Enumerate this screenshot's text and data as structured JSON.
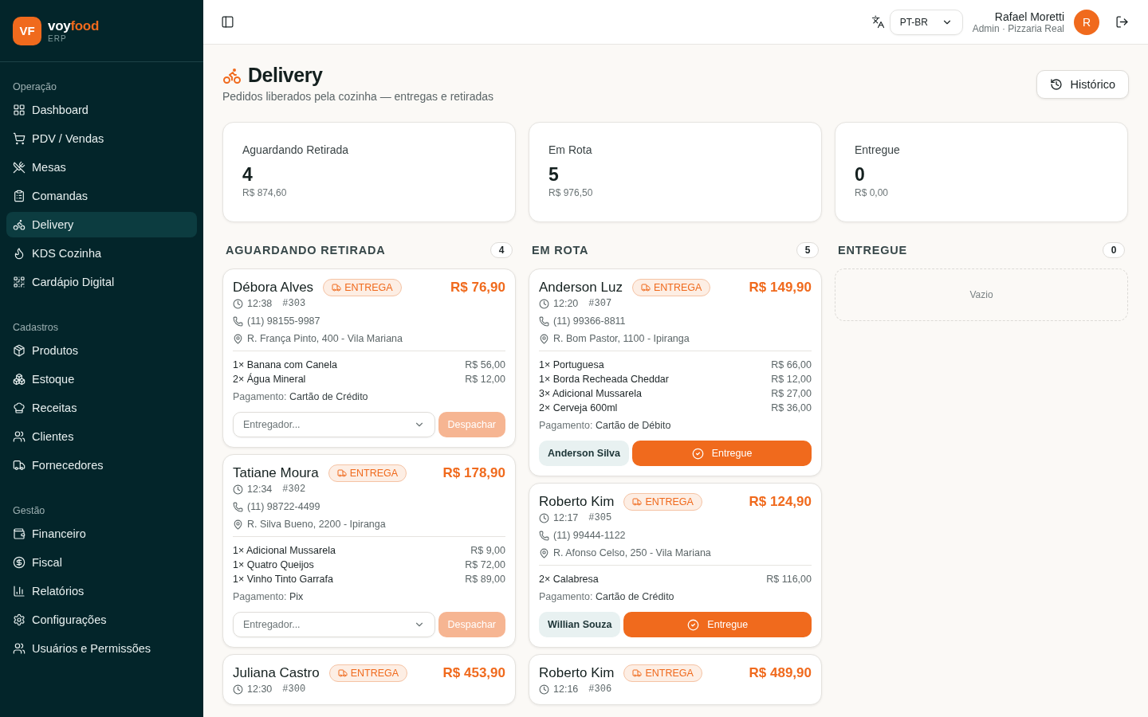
{
  "sidebar": {
    "logo": {
      "initials": "VF",
      "brand_start": "voy",
      "brand_end": "food",
      "subtitle": "ERP"
    },
    "sections": [
      {
        "title": "Operação",
        "items": [
          {
            "label": "Dashboard",
            "selected": false
          },
          {
            "label": "PDV / Vendas",
            "selected": false
          },
          {
            "label": "Mesas",
            "selected": false
          },
          {
            "label": "Comandas",
            "selected": false
          },
          {
            "label": "Delivery",
            "selected": true
          },
          {
            "label": "KDS Cozinha",
            "selected": false
          },
          {
            "label": "Cardápio Digital",
            "selected": false
          }
        ]
      },
      {
        "title": "Cadastros",
        "items": [
          {
            "label": "Produtos",
            "selected": false
          },
          {
            "label": "Estoque",
            "selected": false
          },
          {
            "label": "Receitas",
            "selected": false
          },
          {
            "label": "Clientes",
            "selected": false
          },
          {
            "label": "Fornecedores",
            "selected": false
          }
        ]
      },
      {
        "title": "Gestão",
        "items": [
          {
            "label": "Financeiro",
            "selected": false
          },
          {
            "label": "Fiscal",
            "selected": false
          },
          {
            "label": "Relatórios",
            "selected": false
          },
          {
            "label": "Configurações",
            "selected": false
          },
          {
            "label": "Usuários e Permissões",
            "selected": false
          }
        ]
      }
    ]
  },
  "topbar": {
    "language": "PT-BR",
    "user_name": "Rafael Moretti",
    "user_role": "Admin · Pizzaria Real",
    "avatar": "R"
  },
  "header": {
    "title": "Delivery",
    "subtitle": "Pedidos liberados pela cozinha — entregas e retiradas",
    "history_button": "Histórico"
  },
  "stats": [
    {
      "label": "Aguardando Retirada",
      "count": "4",
      "amount": "R$ 874,60"
    },
    {
      "label": "Em Rota",
      "count": "5",
      "amount": "R$ 976,50"
    },
    {
      "label": "Entregue",
      "count": "0",
      "amount": "R$ 0,00"
    }
  ],
  "columns": [
    {
      "title": "AGUARDANDO RETIRADA",
      "count": "4",
      "orders": [
        {
          "name": "Débora Alves",
          "tag": "ENTREGA",
          "total": "R$ 76,90",
          "time": "12:38",
          "number": "#303",
          "phone": "(11) 98155-9987",
          "address": "R. França Pinto, 400 - Vila Mariana",
          "items": [
            {
              "name": "1× Banana com Canela",
              "price": "R$ 56,00"
            },
            {
              "name": "2× Água Mineral",
              "price": "R$ 12,00"
            }
          ],
          "payment_label": "Pagamento:",
          "payment": "Cartão de Crédito",
          "action": {
            "kind": "dispatch",
            "placeholder": "Entregador...",
            "button": "Despachar",
            "disabled": true
          }
        },
        {
          "name": "Tatiane Moura",
          "tag": "ENTREGA",
          "total": "R$ 178,90",
          "time": "12:34",
          "number": "#302",
          "phone": "(11) 98722-4499",
          "address": "R. Silva Bueno, 2200 - Ipiranga",
          "items": [
            {
              "name": "1× Adicional Mussarela",
              "price": "R$ 9,00"
            },
            {
              "name": "1× Quatro Queijos",
              "price": "R$ 72,00"
            },
            {
              "name": "1× Vinho Tinto Garrafa",
              "price": "R$ 89,00"
            }
          ],
          "payment_label": "Pagamento:",
          "payment": "Pix",
          "action": {
            "kind": "dispatch",
            "placeholder": "Entregador...",
            "button": "Despachar",
            "disabled": true
          }
        },
        {
          "name": "Juliana Castro",
          "tag": "ENTREGA",
          "total": "R$ 453,90",
          "time": "12:30",
          "number": "#300"
        }
      ]
    },
    {
      "title": "EM ROTA",
      "count": "5",
      "orders": [
        {
          "name": "Anderson Luz",
          "tag": "ENTREGA",
          "total": "R$ 149,90",
          "time": "12:20",
          "number": "#307",
          "phone": "(11) 99366-8811",
          "address": "R. Bom Pastor, 1100 - Ipiranga",
          "items": [
            {
              "name": "1× Portuguesa",
              "price": "R$ 66,00"
            },
            {
              "name": "1× Borda Recheada Cheddar",
              "price": "R$ 12,00"
            },
            {
              "name": "3× Adicional Mussarela",
              "price": "R$ 27,00"
            },
            {
              "name": "2× Cerveja 600ml",
              "price": "R$ 36,00"
            }
          ],
          "payment_label": "Pagamento:",
          "payment": "Cartão de Débito",
          "action": {
            "kind": "deliver",
            "courier": "Anderson Silva",
            "button": "Entregue"
          }
        },
        {
          "name": "Roberto Kim",
          "tag": "ENTREGA",
          "total": "R$ 124,90",
          "time": "12:17",
          "number": "#305",
          "phone": "(11) 99444-1122",
          "address": "R. Afonso Celso, 250 - Vila Mariana",
          "items": [
            {
              "name": "2× Calabresa",
              "price": "R$ 116,00"
            }
          ],
          "payment_label": "Pagamento:",
          "payment": "Cartão de Crédito",
          "action": {
            "kind": "deliver",
            "courier": "Willian Souza",
            "button": "Entregue"
          }
        },
        {
          "name": "Roberto Kim",
          "tag": "ENTREGA",
          "total": "R$ 489,90",
          "time": "12:16",
          "number": "#306"
        }
      ]
    },
    {
      "title": "ENTREGUE",
      "count": "0",
      "empty_text": "Vazio"
    }
  ]
}
